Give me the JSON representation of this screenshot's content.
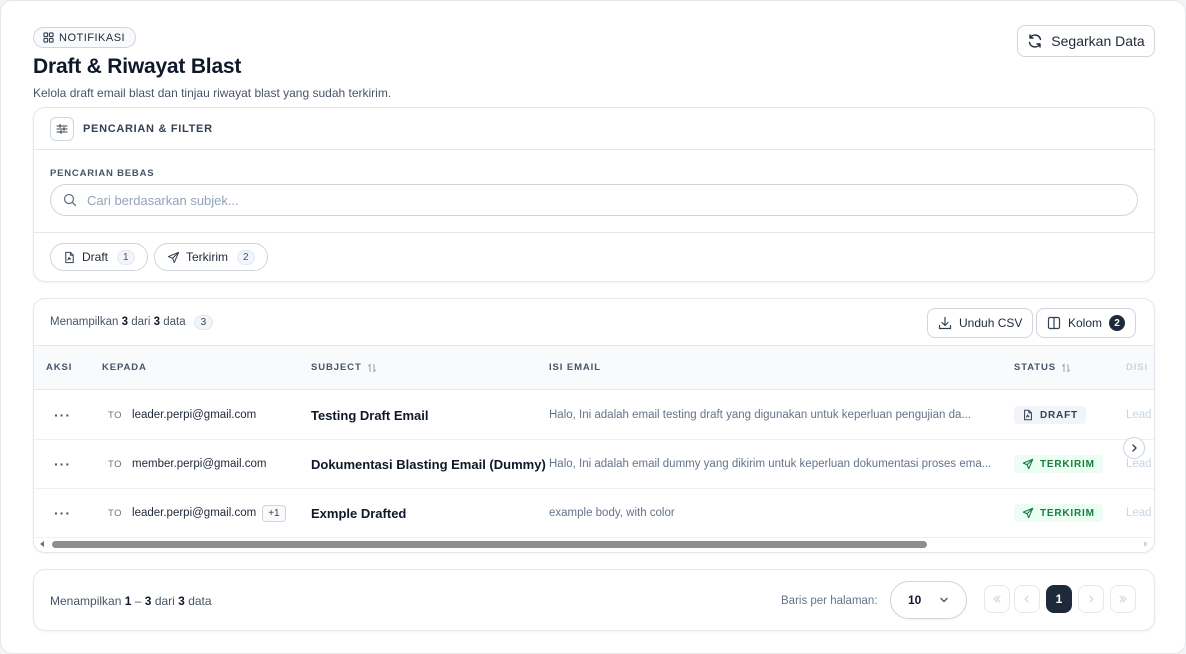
{
  "header": {
    "badge": "NOTIFIKASI",
    "title": "Draft & Riwayat Blast",
    "subtitle": "Kelola draft email blast dan tinjau riwayat blast yang sudah terkirim.",
    "refresh_label": "Segarkan Data"
  },
  "filter": {
    "title": "PENCARIAN & FILTER",
    "search_label": "PENCARIAN BEBAS",
    "search_placeholder": "Cari berdasarkan subjek...",
    "search_value": "",
    "chips": [
      {
        "label": "Draft",
        "count": "1"
      },
      {
        "label": "Terkirim",
        "count": "2"
      }
    ]
  },
  "table": {
    "summary_prefix": "Menampilkan",
    "summary_shown": "3",
    "summary_mid": "dari",
    "summary_total": "3",
    "summary_suffix": "data",
    "summary_count": "3",
    "csv_label": "Unduh CSV",
    "columns_label": "Kolom",
    "columns_count": "2",
    "headers": {
      "aksi": "AKSI",
      "kepada": "KEPADA",
      "subject": "SUBJECT",
      "isi": "ISI EMAIL",
      "status": "STATUS",
      "next": "DISI"
    },
    "to_tag": "TO",
    "rows": [
      {
        "to": "leader.perpi@gmail.com",
        "extra": "",
        "subject": "Testing Draft Email",
        "body": "Halo, Ini adalah email testing draft yang digunakan untuk keperluan pengujian da...",
        "status": "DRAFT",
        "next": "Lead"
      },
      {
        "to": "member.perpi@gmail.com",
        "extra": "",
        "subject": "Dokumentasi Blasting Email (Dummy)",
        "body": "Halo, Ini adalah email dummy yang dikirim untuk keperluan dokumentasi proses ema...",
        "status": "TERKIRIM",
        "next": "Lead"
      },
      {
        "to": "leader.perpi@gmail.com",
        "extra": "+1",
        "subject": "Exmple Drafted",
        "body": "example body, with color",
        "status": "TERKIRIM",
        "next": "Lead"
      }
    ]
  },
  "pagination": {
    "prefix": "Menampilkan",
    "from": "1",
    "dash": "–",
    "to": "3",
    "mid": "dari",
    "total": "3",
    "suffix": "data",
    "rows_label": "Baris per halaman:",
    "rows_value": "10",
    "current_page": "1"
  },
  "colors": {
    "accent": "#1e293b",
    "sent_green": "#15803d",
    "sent_bg": "#ecfdf3",
    "draft_bg": "#f1f5f9"
  }
}
